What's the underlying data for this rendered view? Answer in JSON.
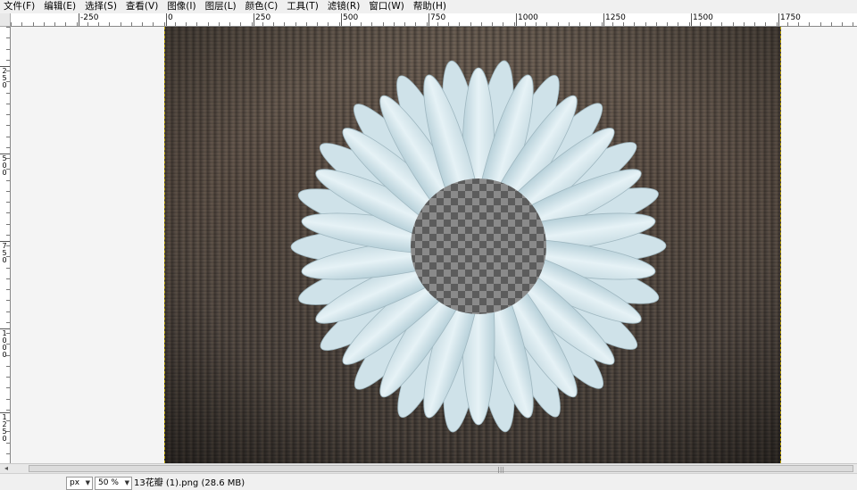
{
  "menu": {
    "items": [
      "文件(F)",
      "编辑(E)",
      "选择(S)",
      "查看(V)",
      "图像(I)",
      "图层(L)",
      "颜色(C)",
      "工具(T)",
      "滤镜(R)",
      "窗口(W)",
      "帮助(H)"
    ]
  },
  "rulers": {
    "horizontal_labels": [
      "-250",
      "0",
      "250",
      "500",
      "750",
      "1000",
      "1250",
      "1500",
      "1750"
    ],
    "vertical_labels": [
      "250",
      "500",
      "750",
      "1000",
      "1250"
    ]
  },
  "scrollbar": {
    "left_arrow": "◂",
    "grip": "|||"
  },
  "status": {
    "unit": "px",
    "zoom": "50 %",
    "file_info": "13花瓣 (1).png (28.6 MB)"
  },
  "colors": {
    "petal": "#e6f2f6",
    "petal_shade": "#b8d1da",
    "checker_dark": "#5c5c5c",
    "checker_light": "#8a8a8a",
    "wood": "#5a4f47",
    "selection_border": "#b8a000"
  }
}
